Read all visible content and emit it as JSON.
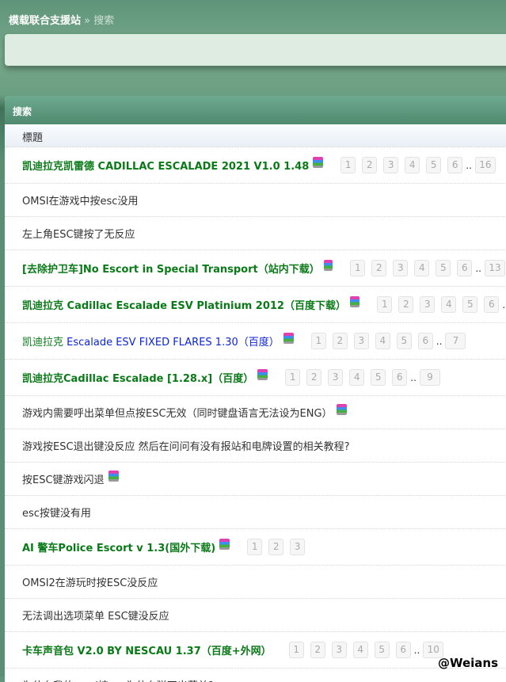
{
  "breadcrumb": {
    "site": "模载联合支援站",
    "sep": "»",
    "current": "搜索"
  },
  "panel": {
    "title": "搜索",
    "column_header": "標題"
  },
  "rows": [
    {
      "title": "凯迪拉克凯雷德 CADILLAC ESCALADE 2021 V1.0 1.48",
      "style": "hl",
      "zip": true,
      "pages": [
        "1",
        "2",
        "3",
        "4",
        "5",
        "6"
      ],
      "last": "16"
    },
    {
      "title": "OMSI在游戏中按esc没用",
      "style": ""
    },
    {
      "title": "左上角ESC键按了无反应",
      "style": ""
    },
    {
      "title": "[去除护卫车]No Escort in Special Transport（站内下载）",
      "style": "hl",
      "zip": true,
      "pages": [
        "1",
        "2",
        "3",
        "4",
        "5",
        "6"
      ],
      "last": "13"
    },
    {
      "title": "凯迪拉克 Cadillac Escalade ESV Platinium 2012（百度下载）",
      "style": "hl",
      "zip": true,
      "pages": [
        "1",
        "2",
        "3",
        "4",
        "5",
        "6"
      ],
      "last": ""
    },
    {
      "prefix": "凯迪拉克 ",
      "title": "Escalade ESV FIXED FLARES 1.30（百度）",
      "style": "blue",
      "zip": true,
      "pages": [
        "1",
        "2",
        "3",
        "4",
        "5",
        "6"
      ],
      "last": "7"
    },
    {
      "title": "凯迪拉克Cadillac Escalade [1.28.x]（百度）",
      "style": "hl",
      "zip": true,
      "pages": [
        "1",
        "2",
        "3",
        "4",
        "5",
        "6"
      ],
      "last": "9"
    },
    {
      "title": "游戏内需要呼出菜单但点按ESC无效（同时键盘语言无法设为ENG）",
      "style": "",
      "zip": true
    },
    {
      "title": "游戏按ESC退出键没反应 然后在问问有没有报站和电牌设置的相关教程?",
      "style": ""
    },
    {
      "title": "按ESC键游戏闪退",
      "style": "",
      "zip": true
    },
    {
      "title": "esc按键没有用",
      "style": ""
    },
    {
      "title": "AI 警车Police Escort v 1.3(国外下载)",
      "style": "hl",
      "zip": true,
      "pages": [
        "1",
        "2",
        "3"
      ]
    },
    {
      "title": "OMSI2在游玩时按ESC没反应",
      "style": ""
    },
    {
      "title": "无法调出选项菜单 ESC键没反应",
      "style": ""
    },
    {
      "title": "卡车声音包 V2.0 BY NESCAU 1.37（百度+外网）",
      "style": "hl",
      "pages": [
        "1",
        "2",
        "3",
        "4",
        "5",
        "6"
      ],
      "last": "10"
    },
    {
      "title": "为什么我的omsi按esc为什么弹不出菜单?",
      "style": ""
    }
  ],
  "watermark": "@Weians"
}
